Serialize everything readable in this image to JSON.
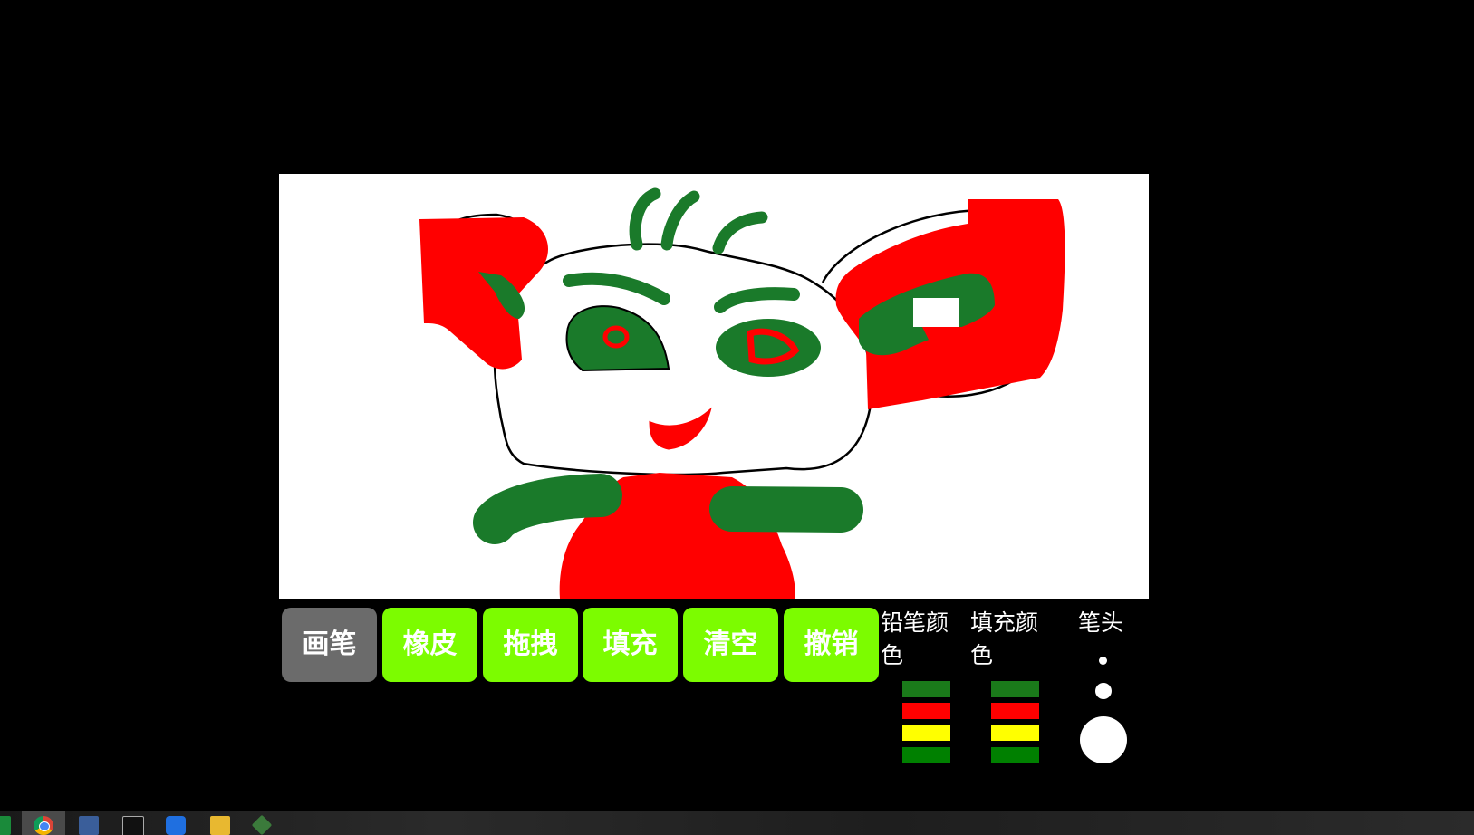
{
  "tools": [
    {
      "label": "画笔",
      "active": true
    },
    {
      "label": "橡皮",
      "active": false
    },
    {
      "label": "拖拽",
      "active": false
    },
    {
      "label": "填充",
      "active": false
    },
    {
      "label": "清空",
      "active": false
    },
    {
      "label": "撤销",
      "active": false
    }
  ],
  "pencil_color": {
    "label": "铅笔颜色",
    "swatches": [
      "#1a7a1a",
      "#ff0000",
      "#ffff00",
      "#008000"
    ]
  },
  "fill_color": {
    "label": "填充颜色",
    "swatches": [
      "#1a7a1a",
      "#ff0000",
      "#ffff00",
      "#008000"
    ]
  },
  "pen_tip": {
    "label": "笔头",
    "sizes": [
      "small",
      "medium",
      "large"
    ]
  },
  "colors": {
    "background": "#000000",
    "canvas": "#ffffff",
    "button": "#7cfc00",
    "button_active": "#6b6b6b",
    "drawing_green": "#1a7a2a",
    "drawing_red": "#ff0000"
  },
  "taskbar": {
    "icons": [
      "app-icon",
      "chrome-icon",
      "remote-desktop-icon",
      "terminal-icon",
      "feishu-icon",
      "file-explorer-icon",
      "git-icon"
    ]
  }
}
